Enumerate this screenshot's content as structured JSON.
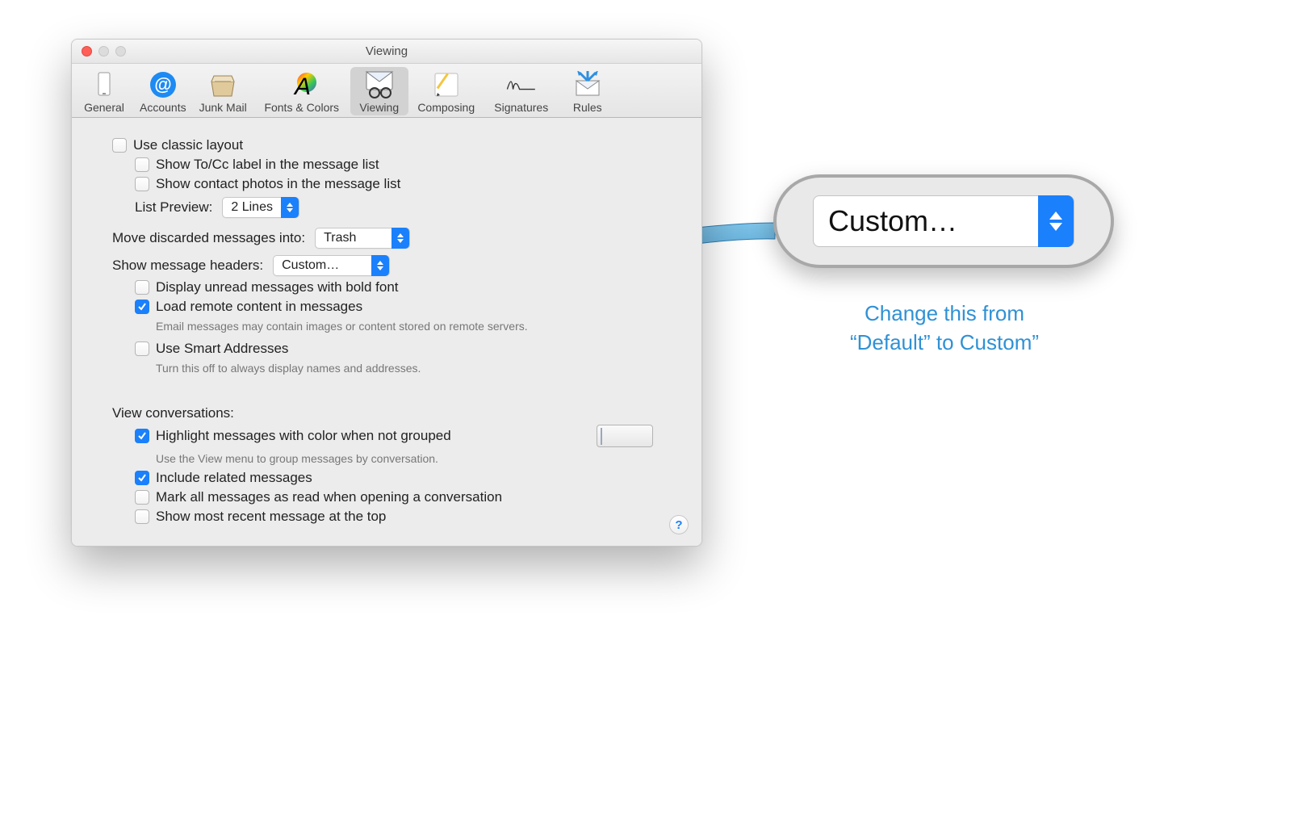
{
  "window": {
    "title": "Viewing",
    "toolbar": [
      {
        "id": "general",
        "label": "General"
      },
      {
        "id": "accounts",
        "label": "Accounts"
      },
      {
        "id": "junk",
        "label": "Junk Mail"
      },
      {
        "id": "fonts",
        "label": "Fonts & Colors"
      },
      {
        "id": "viewing",
        "label": "Viewing",
        "selected": true
      },
      {
        "id": "composing",
        "label": "Composing"
      },
      {
        "id": "signatures",
        "label": "Signatures"
      },
      {
        "id": "rules",
        "label": "Rules"
      }
    ]
  },
  "options": {
    "use_classic_layout": {
      "label": "Use classic layout",
      "checked": false
    },
    "show_to_cc": {
      "label": "Show To/Cc label in the message list",
      "checked": false
    },
    "show_contact_photos": {
      "label": "Show contact photos in the message list",
      "checked": false
    },
    "list_preview": {
      "label": "List Preview:",
      "value": "2 Lines"
    },
    "move_discarded": {
      "label": "Move discarded messages into:",
      "value": "Trash"
    },
    "show_headers": {
      "label": "Show message headers:",
      "value": "Custom…"
    },
    "display_bold": {
      "label": "Display unread messages with bold font",
      "checked": false
    },
    "load_remote": {
      "label": "Load remote content in messages",
      "checked": true,
      "hint": "Email messages may contain images or content stored on remote servers."
    },
    "smart_addresses": {
      "label": "Use Smart Addresses",
      "checked": false,
      "hint": "Turn this off to always display names and addresses."
    },
    "conversations_heading": "View conversations:",
    "highlight_color": {
      "label": "Highlight messages with color when not grouped",
      "checked": true,
      "hint": "Use the View menu to group messages by conversation."
    },
    "include_related": {
      "label": "Include related messages",
      "checked": true
    },
    "mark_read": {
      "label": "Mark all messages as read when opening a conversation",
      "checked": false
    },
    "recent_top": {
      "label": "Show most recent message at the top",
      "checked": false
    }
  },
  "help_glyph": "?",
  "callout": {
    "value": "Custom…",
    "caption_line1": "Change this from",
    "caption_line2": "“Default” to Custom”"
  }
}
